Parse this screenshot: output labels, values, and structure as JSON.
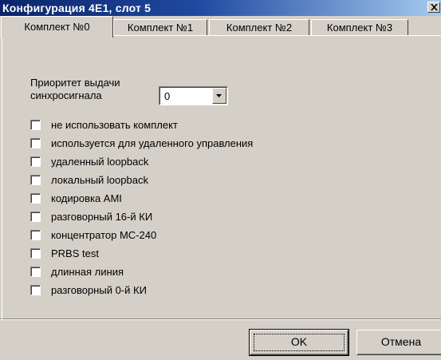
{
  "window": {
    "title": "Конфигурация 4E1, слот 5"
  },
  "tabs": [
    {
      "label": "Комплект №0",
      "active": true
    },
    {
      "label": "Комплект №1",
      "active": false
    },
    {
      "label": "Комплект №2",
      "active": false
    },
    {
      "label": "Комплект №3",
      "active": false
    }
  ],
  "priority": {
    "label_line1": "Приоритет выдачи",
    "label_line2": "синхросигнала",
    "value": "0"
  },
  "checkboxes": [
    {
      "label": "не использовать комплект",
      "checked": false
    },
    {
      "label": "используется для удаленного управления",
      "checked": false
    },
    {
      "label": "удаленный loopback",
      "checked": false
    },
    {
      "label": "локальный loopback",
      "checked": false
    },
    {
      "label": "кодировка AMI",
      "checked": false
    },
    {
      "label": "разговорный 16-й КИ",
      "checked": false
    },
    {
      "label": "концентратор МС-240",
      "checked": false
    },
    {
      "label": "PRBS test",
      "checked": false
    },
    {
      "label": "длинная линия",
      "checked": false
    },
    {
      "label": "разговорный 0-й КИ",
      "checked": false
    }
  ],
  "buttons": {
    "ok": "OK",
    "cancel": "Отмена"
  }
}
